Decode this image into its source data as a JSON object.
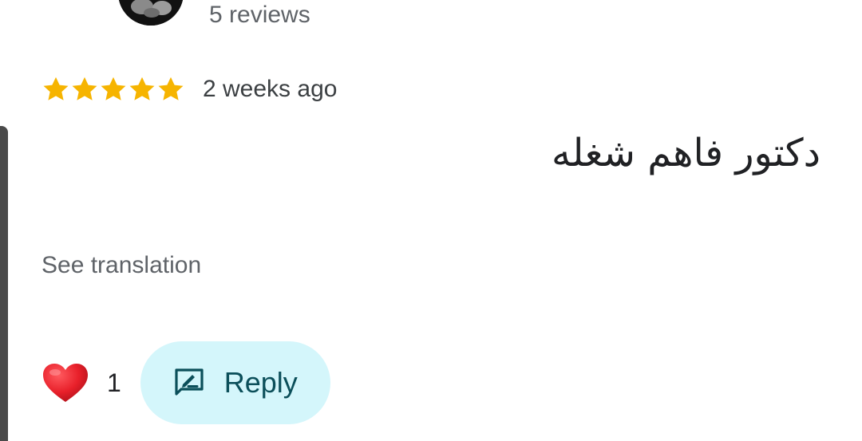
{
  "reviewer": {
    "review_count": "5 reviews"
  },
  "rating": {
    "stars": 5,
    "max_stars": 5,
    "star_color": "#f6b400",
    "time": "2 weeks ago"
  },
  "review": {
    "text": "دكتور فاهم شغله",
    "see_translation": "See translation"
  },
  "actions": {
    "like_count": "1",
    "reply_label": "Reply",
    "reply_bg": "#d4f6fb",
    "heart_color": "#e8202a"
  }
}
